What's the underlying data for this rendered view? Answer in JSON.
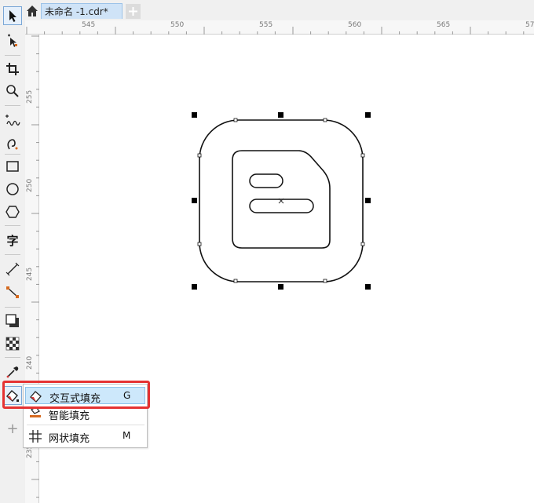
{
  "tabs": {
    "document_tab_label": "未命名 -1.cdr*",
    "home_icon": "home-icon",
    "add_tab_icon": "plus-icon"
  },
  "ruler": {
    "horizontal_labels": [
      "545",
      "550",
      "555",
      "560",
      "565",
      "57"
    ],
    "vertical_labels": [
      "255",
      "250",
      "245",
      "240",
      "235"
    ]
  },
  "toolbox": {
    "text_tool_glyph": "字",
    "add_tool_glyph": "+"
  },
  "flyout": {
    "items": [
      {
        "label": "交互式填充",
        "shortcut": "G",
        "icon": "interactive-fill-icon"
      },
      {
        "label": "智能填充",
        "shortcut": "",
        "icon": "smart-fill-icon"
      },
      {
        "label": "网状填充",
        "shortcut": "M",
        "icon": "mesh-fill-icon"
      }
    ]
  },
  "colors": {
    "tab_active": "#cfe3f7",
    "flyout_selected": "#cde8fb",
    "highlight_border": "#e53232",
    "canvas": "#ffffff"
  }
}
